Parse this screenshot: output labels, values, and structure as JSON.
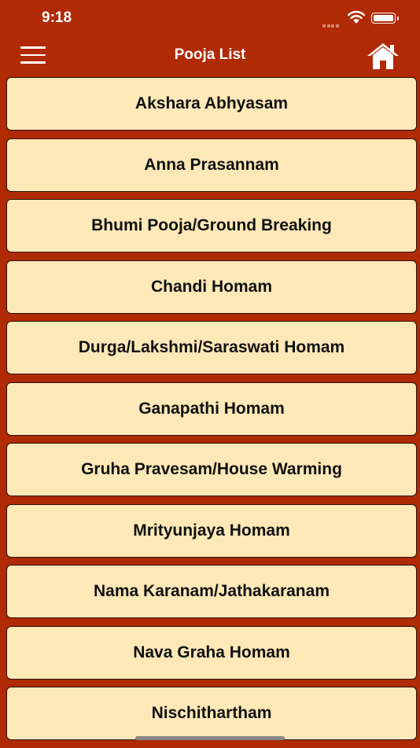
{
  "status_bar": {
    "time": "9:18"
  },
  "header": {
    "title": "Pooja List",
    "menu_icon": "hamburger-icon",
    "home_icon": "home-icon"
  },
  "colors": {
    "background": "#b02a05",
    "item_bg": "#fde8b8",
    "item_border": "#2a1208",
    "text": "#111111"
  },
  "pooja_list": [
    {
      "label": "Akshara Abhyasam"
    },
    {
      "label": "Anna Prasannam"
    },
    {
      "label": "Bhumi Pooja/Ground Breaking"
    },
    {
      "label": "Chandi Homam"
    },
    {
      "label": "Durga/Lakshmi/Saraswati Homam"
    },
    {
      "label": "Ganapathi Homam"
    },
    {
      "label": "Gruha Pravesam/House Warming"
    },
    {
      "label": "Mrityunjaya Homam"
    },
    {
      "label": "Nama Karanam/Jathakaranam"
    },
    {
      "label": "Nava Graha Homam"
    },
    {
      "label": "Nischithartham"
    }
  ]
}
